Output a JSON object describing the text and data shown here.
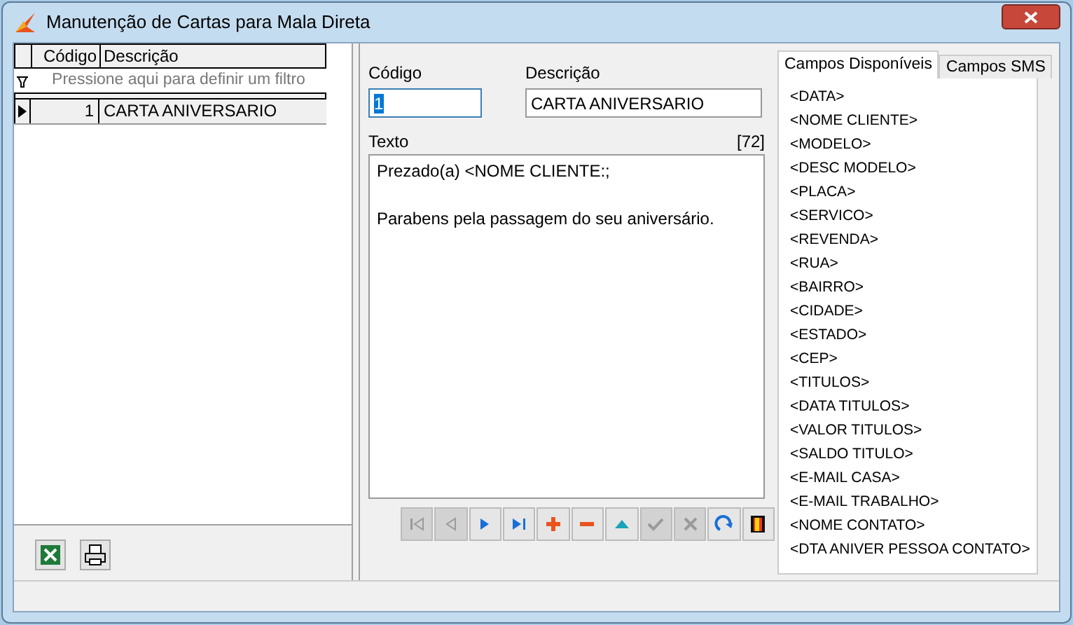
{
  "window": {
    "title": "Manutenção de Cartas para Mala Direta"
  },
  "grid": {
    "columns": [
      "Código",
      "Descrição"
    ],
    "filter_hint": "Pressione aqui para definir um filtro",
    "rows": [
      {
        "codigo": "1",
        "descricao": "CARTA ANIVERSARIO",
        "selected": true
      }
    ]
  },
  "left_toolbar": [
    {
      "kind": "excel"
    },
    {
      "kind": "print"
    }
  ],
  "form": {
    "codigo_label": "Código",
    "codigo_value": "1",
    "descricao_label": "Descrição",
    "descricao_value": "CARTA ANIVERSARIO",
    "texto_label": "Texto",
    "texto_count": "[72]",
    "texto_paragraphs": [
      "Prezado(a) <NOME CLIENTE:;",
      "Parabens pela passagem do seu aniversário."
    ]
  },
  "navigator": [
    {
      "kind": "first",
      "disabled": true
    },
    {
      "kind": "prior",
      "disabled": true
    },
    {
      "kind": "next",
      "disabled": false
    },
    {
      "kind": "last",
      "disabled": false
    },
    {
      "kind": "insert",
      "disabled": false
    },
    {
      "kind": "delete",
      "disabled": false
    },
    {
      "kind": "edit",
      "disabled": false
    },
    {
      "kind": "post",
      "disabled": true
    },
    {
      "kind": "cancel",
      "disabled": true
    },
    {
      "kind": "refresh",
      "disabled": false
    },
    {
      "kind": "exit",
      "disabled": false
    }
  ],
  "tabs": [
    {
      "label": "Campos Disponíveis",
      "selected": true
    },
    {
      "label": "Campos SMS",
      "selected": false
    }
  ],
  "fields": [
    "<DATA>",
    "<NOME CLIENTE>",
    "<MODELO>",
    "<DESC MODELO>",
    "<PLACA>",
    "<SERVICO>",
    "<REVENDA>",
    "<RUA>",
    "<BAIRRO>",
    "<CIDADE>",
    "<ESTADO>",
    "<CEP>",
    "<TITULOS>",
    "<DATA TITULOS>",
    "<VALOR TITULOS>",
    "<SALDO TITULO>",
    "<E-MAIL CASA>",
    "<E-MAIL TRABALHO>",
    "<NOME CONTATO>",
    "<DTA ANIVER PESSOA CONTATO>"
  ]
}
